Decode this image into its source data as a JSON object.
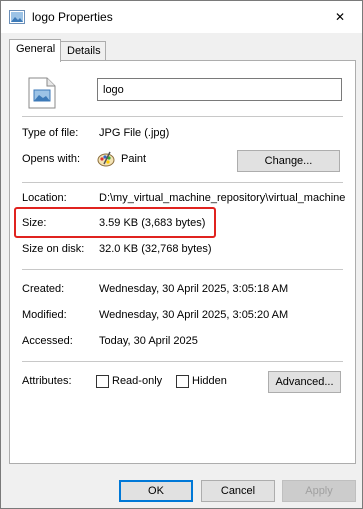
{
  "window": {
    "title": "logo Properties",
    "close_glyph": "✕"
  },
  "tabs": [
    {
      "label": "General",
      "active": true
    },
    {
      "label": "Details",
      "active": false
    }
  ],
  "file": {
    "name_value": "logo"
  },
  "fields": {
    "type_label": "Type of file:",
    "type_value": "JPG File (.jpg)",
    "opens_label": "Opens with:",
    "opens_value": "Paint",
    "change_button": "Change...",
    "location_label": "Location:",
    "location_value": "D:\\my_virtual_machine_repository\\virtual_machine",
    "size_label": "Size:",
    "size_value": "3.59 KB (3,683 bytes)",
    "size_on_disk_label": "Size on disk:",
    "size_on_disk_value": "32.0 KB (32,768 bytes)",
    "created_label": "Created:",
    "created_value": "Wednesday, 30 April 2025, 3:05:18 AM",
    "modified_label": "Modified:",
    "modified_value": "Wednesday, 30 April 2025, 3:05:20 AM",
    "accessed_label": "Accessed:",
    "accessed_value": "Today, 30 April 2025",
    "attributes_label": "Attributes:",
    "readonly_label": "Read-only",
    "hidden_label": "Hidden",
    "advanced_button": "Advanced..."
  },
  "buttons": {
    "ok": "OK",
    "cancel": "Cancel",
    "apply": "Apply"
  },
  "colors": {
    "highlight": "#e0231f",
    "accent": "#0078d7"
  }
}
